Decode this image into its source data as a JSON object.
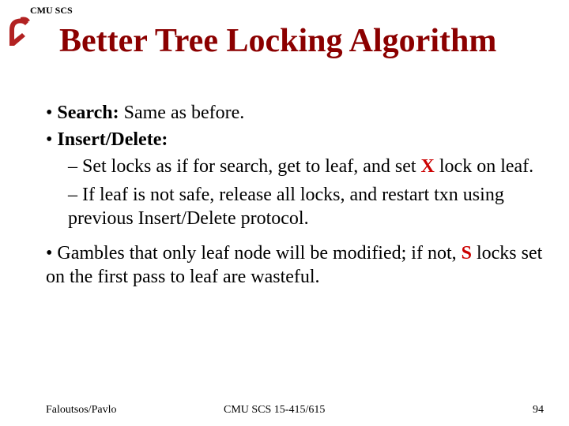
{
  "header": {
    "dept": "CMU SCS"
  },
  "title": "Better Tree Locking Algorithm",
  "bullets": {
    "b1_label": "Search:",
    "b1_text": " Same as before.",
    "b2_label": "Insert/Delete:",
    "sub1_pre": "– Set locks as if for search, get to leaf, and set ",
    "sub1_x": "X",
    "sub1_post": " lock on leaf.",
    "sub2": "– If leaf is not safe, release all locks, and restart txn using previous Insert/Delete protocol.",
    "b3_pre": "• Gambles that only leaf node will be modified; if not, ",
    "b3_s": "S",
    "b3_post": " locks set on the first pass to leaf are wasteful."
  },
  "footer": {
    "authors": "Faloutsos/Pavlo",
    "course": "CMU SCS 15-415/615",
    "page": "94"
  }
}
